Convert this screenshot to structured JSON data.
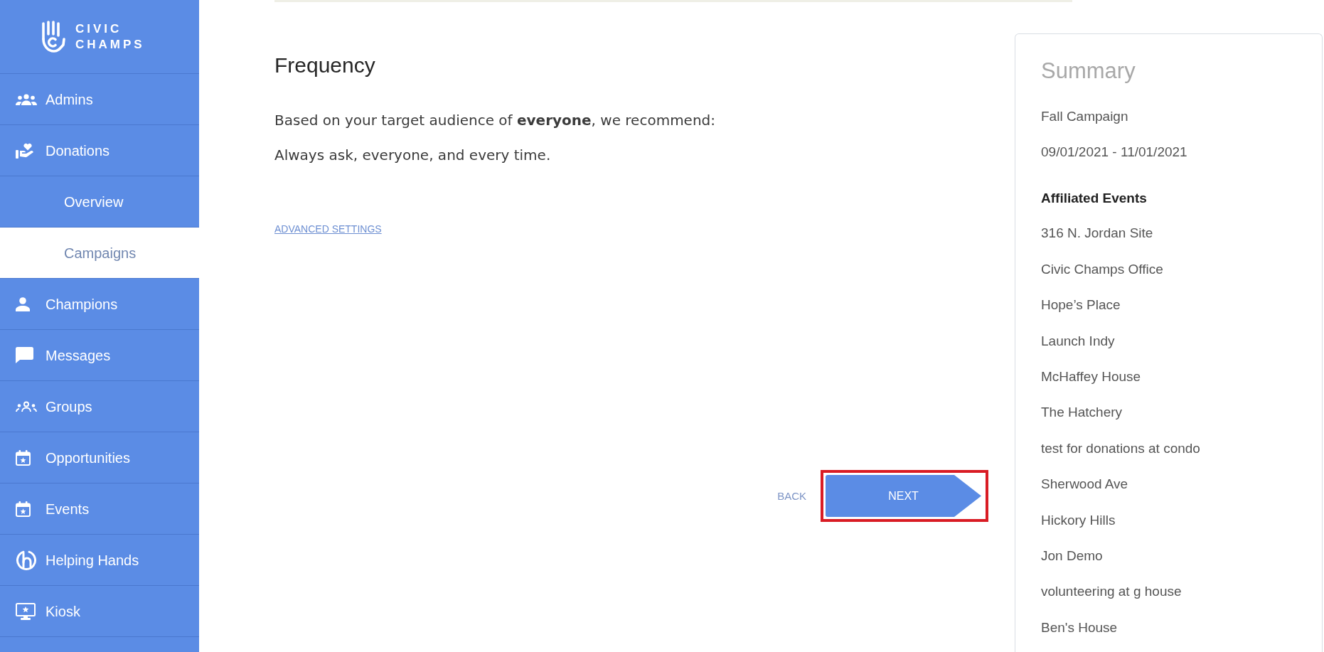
{
  "sidebar": {
    "logo_lines": [
      "CIVIC",
      "CHAMPS"
    ],
    "items": [
      {
        "label": "Admins",
        "kind": "main",
        "selected": false
      },
      {
        "label": "Donations",
        "kind": "main",
        "selected": false
      },
      {
        "label": "Overview",
        "kind": "sub",
        "selected": false
      },
      {
        "label": "Campaigns",
        "kind": "sub",
        "selected": true
      },
      {
        "label": "Champions",
        "kind": "main",
        "selected": false
      },
      {
        "label": "Messages",
        "kind": "main",
        "selected": false
      },
      {
        "label": "Groups",
        "kind": "main",
        "selected": false
      },
      {
        "label": "Opportunities",
        "kind": "main",
        "selected": false
      },
      {
        "label": "Events",
        "kind": "main",
        "selected": false
      },
      {
        "label": "Helping Hands",
        "kind": "main",
        "selected": false
      },
      {
        "label": "Kiosk",
        "kind": "main",
        "selected": false
      }
    ]
  },
  "step": {
    "title": "Frequency",
    "paragraphs": [
      "Based on your target audience of **everyone**, we recommend:",
      "Always ask, everyone, and every time."
    ],
    "advanced_link": "ADVANCED SETTINGS"
  },
  "actions": {
    "back": "BACK",
    "next": {
      "label": "NEXT",
      "highlighted": true
    }
  },
  "summary": {
    "title": "Summary",
    "campaign": "Fall Campaign",
    "dates": "09/01/2021 - 11/01/2021",
    "events_heading": "Affiliated Events",
    "events": [
      "316 N. Jordan Site",
      "Civic Champs Office",
      "Hope’s Place",
      "Launch Indy",
      "McHaffey House",
      "The Hatchery",
      "test for donations at condo",
      "Sherwood Ave",
      "Hickory Hills",
      "Jon Demo",
      "volunteering at g house",
      "Ben's House"
    ]
  }
}
